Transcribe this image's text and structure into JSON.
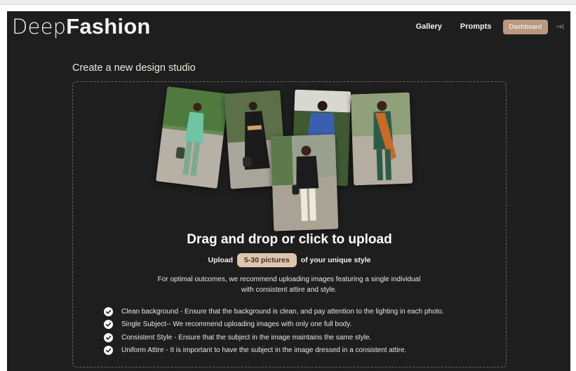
{
  "brand": {
    "light": "Deep",
    "bold": "Fashion"
  },
  "nav": {
    "items": [
      {
        "label": "Gallery",
        "active": false
      },
      {
        "label": "Prompts",
        "active": false
      },
      {
        "label": "Dashboard",
        "active": true
      }
    ],
    "logout_icon": "logout-icon"
  },
  "page": {
    "title": "Create a new design studio"
  },
  "upload": {
    "headline": "Drag and drop or click to upload",
    "count_prefix": "Upload",
    "count_pill": "5-30 pictures",
    "count_suffix": "of your unique style",
    "hint": "For optimal outcomes, we recommend uploading images featuring a single individual with consistent attire and style.",
    "photos": [
      "photo-green-suit-model",
      "photo-black-dress-model",
      "photo-blue-jacket-model",
      "photo-black-blazer-model",
      "photo-orange-scarf-model"
    ]
  },
  "checklist": [
    "Clean background - Ensure that the background is clean, and pay attention to the lighting in each photo.",
    "Single Subject-- We recommend uploading images with only one full body.",
    "Consistent Style - Ensure that the subject in the image maintains the same style.",
    "Uniform Attire - It is important to have the subject in the image dressed in a consistent attire."
  ],
  "colors": {
    "background": "#1e1e1e",
    "accent": "#b99882",
    "pill": "#dcc6b0",
    "title": "#ede8dc"
  }
}
